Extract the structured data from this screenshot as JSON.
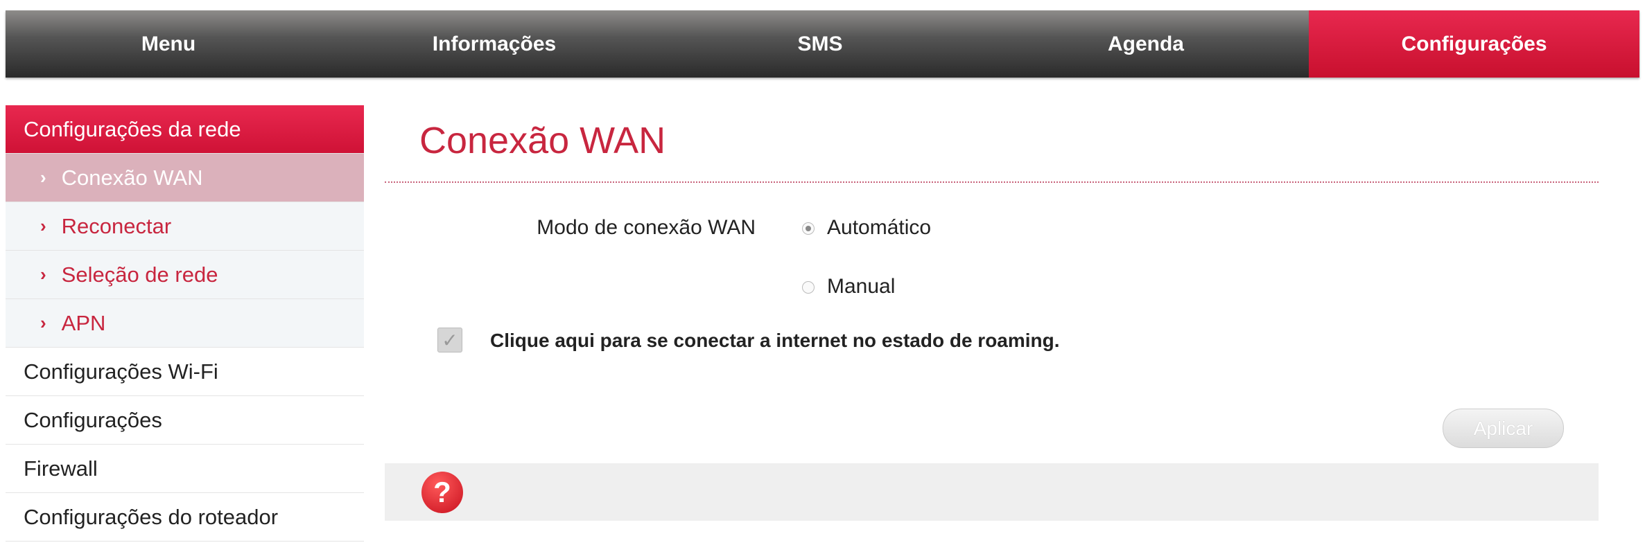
{
  "nav": {
    "items": [
      {
        "label": "Menu"
      },
      {
        "label": "Informações"
      },
      {
        "label": "SMS"
      },
      {
        "label": "Agenda"
      },
      {
        "label": "Configurações",
        "active": true
      }
    ]
  },
  "sidebar": {
    "section": "Configurações da rede",
    "subitems": [
      {
        "label": "Conexão WAN",
        "selected": true
      },
      {
        "label": "Reconectar"
      },
      {
        "label": "Seleção de rede"
      },
      {
        "label": "APN"
      }
    ],
    "items": [
      {
        "label": "Configurações Wi-Fi"
      },
      {
        "label": "Configurações"
      },
      {
        "label": "Firewall"
      },
      {
        "label": "Configurações do roteador"
      }
    ]
  },
  "main": {
    "title": "Conexão WAN",
    "mode_label": "Modo de conexão WAN",
    "options": [
      {
        "label": "Automático",
        "selected": true
      },
      {
        "label": "Manual",
        "selected": false
      }
    ],
    "roaming_checkbox": {
      "label": "Clique aqui para se conectar a internet no estado de roaming.",
      "checked": true
    },
    "apply_label": "Aplicar",
    "help_glyph": "?"
  },
  "colors": {
    "accent": "#c8263f",
    "nav_dark": "#2a2a2a",
    "selected_sub": "#dbb1bb"
  }
}
